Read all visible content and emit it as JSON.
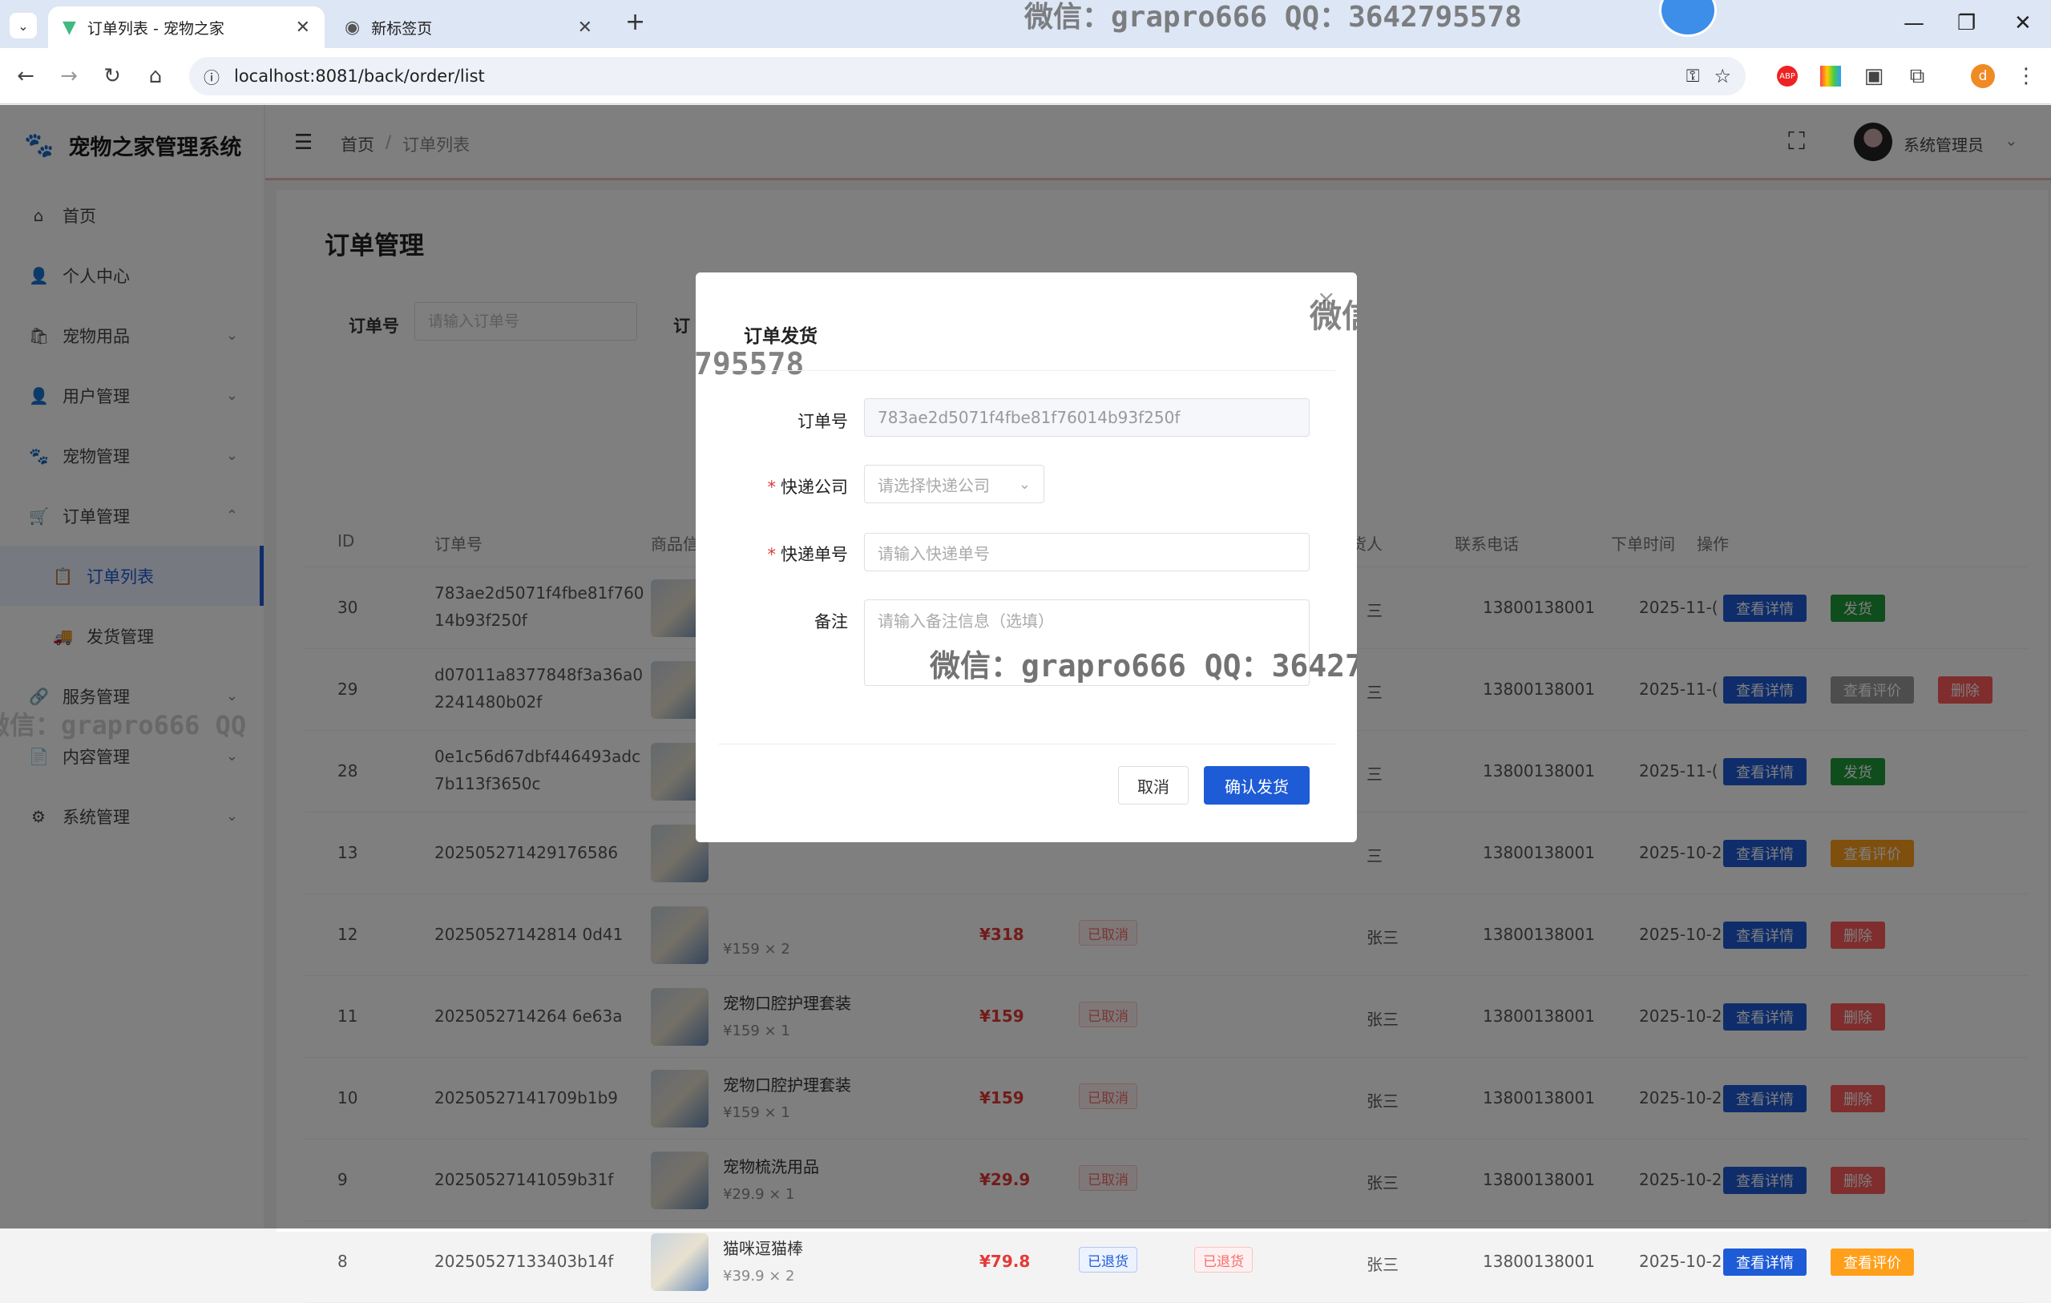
{
  "browser": {
    "tabs": [
      {
        "title": "订单列表 - 宠物之家",
        "active": true
      },
      {
        "title": "新标签页",
        "active": false
      }
    ],
    "url": "localhost:8081/back/order/list",
    "profile_initial": "d"
  },
  "watermark": "微信：grapro666 QQ：3642795578",
  "sidebar": {
    "brand": "宠物之家管理系统",
    "items": [
      {
        "label": "首页",
        "icon": "home-icon",
        "expandable": false
      },
      {
        "label": "个人中心",
        "icon": "user-icon",
        "expandable": false
      },
      {
        "label": "宠物用品",
        "icon": "bag-icon",
        "expandable": true
      },
      {
        "label": "用户管理",
        "icon": "user-icon",
        "expandable": true
      },
      {
        "label": "宠物管理",
        "icon": "paw-icon",
        "expandable": true
      },
      {
        "label": "订单管理",
        "icon": "cart-icon",
        "expandable": true,
        "open": true
      },
      {
        "label": "订单列表",
        "icon": "clipboard-icon",
        "sub": true,
        "active": true
      },
      {
        "label": "发货管理",
        "icon": "truck-icon",
        "sub": true
      },
      {
        "label": "服务管理",
        "icon": "link-icon",
        "expandable": true
      },
      {
        "label": "内容管理",
        "icon": "document-icon",
        "expandable": true
      },
      {
        "label": "系统管理",
        "icon": "gear-icon",
        "expandable": true
      }
    ]
  },
  "topbar": {
    "breadcrumb_home": "首页",
    "breadcrumb_sep": "/",
    "breadcrumb_current": "订单列表",
    "user_name": "系统管理员"
  },
  "page": {
    "title": "订单管理",
    "filter_order_label": "订单号",
    "filter_order_placeholder": "请输入订单号",
    "filter_second_label_partial": "订"
  },
  "table": {
    "headers": {
      "id": "ID",
      "order_no": "订单号",
      "goods": "商品信",
      "receiver": "货人",
      "phone": "联系电话",
      "time": "下单时间",
      "actions": "操作"
    },
    "rows": [
      {
        "id": "30",
        "order_no": [
          "783ae2d5071f4fbe81f760",
          "14b93f250f"
        ],
        "goods": "",
        "qty": "",
        "price": "",
        "status": "",
        "ship": "",
        "receiver": "三",
        "phone": "13800138001",
        "time": "2025-11-(",
        "actions": [
          {
            "label": "查看详情",
            "color": "#1e5bd6"
          },
          {
            "label": "发货",
            "color": "#1f9a39"
          }
        ]
      },
      {
        "id": "29",
        "order_no": [
          "d07011a8377848f3a36a0",
          "2241480b02f"
        ],
        "goods": "",
        "qty": "",
        "price": "",
        "status": "",
        "ship": "",
        "receiver": "三",
        "phone": "13800138001",
        "time": "2025-11-(",
        "actions": [
          {
            "label": "查看详情",
            "color": "#1e5bd6"
          },
          {
            "label": "查看评价",
            "color": "#9b9b9b"
          },
          {
            "label": "删除",
            "color": "#ff5a5a"
          }
        ]
      },
      {
        "id": "28",
        "order_no": [
          "0e1c56d67dbf446493adc",
          "7b113f3650c"
        ],
        "goods": "",
        "qty": "",
        "price": "",
        "status": "",
        "ship": "",
        "receiver": "三",
        "phone": "13800138001",
        "time": "2025-11-(",
        "actions": [
          {
            "label": "查看详情",
            "color": "#1e5bd6"
          },
          {
            "label": "发货",
            "color": "#1f9a39"
          }
        ]
      },
      {
        "id": "13",
        "order_no": [
          "202505271429176586"
        ],
        "goods": "",
        "qty": "",
        "price": "",
        "status": "",
        "ship": "",
        "receiver": "三",
        "phone": "13800138001",
        "time": "2025-10-2",
        "actions": [
          {
            "label": "查看详情",
            "color": "#1e5bd6"
          },
          {
            "label": "查看评价",
            "color": "#ff9f1a"
          }
        ]
      },
      {
        "id": "12",
        "order_no": [
          "20250527142814 0d41"
        ],
        "goods": "",
        "qty": "¥159 × 2",
        "price": "¥318",
        "status": "已取消",
        "ship": "",
        "receiver": "张三",
        "phone": "13800138001",
        "time": "2025-10-2",
        "actions": [
          {
            "label": "查看详情",
            "color": "#1e5bd6"
          },
          {
            "label": "删除",
            "color": "#ff5a5a"
          }
        ]
      },
      {
        "id": "11",
        "order_no": [
          "2025052714264 6e63a"
        ],
        "goods": "宠物口腔护理套装",
        "qty": "¥159 × 1",
        "price": "¥159",
        "status": "已取消",
        "ship": "",
        "receiver": "张三",
        "phone": "13800138001",
        "time": "2025-10-2",
        "actions": [
          {
            "label": "查看详情",
            "color": "#1e5bd6"
          },
          {
            "label": "删除",
            "color": "#ff5a5a"
          }
        ]
      },
      {
        "id": "10",
        "order_no": [
          "20250527141709b1b9"
        ],
        "goods": "宠物口腔护理套装",
        "qty": "¥159 × 1",
        "price": "¥159",
        "status": "已取消",
        "ship": "",
        "receiver": "张三",
        "phone": "13800138001",
        "time": "2025-10-2",
        "actions": [
          {
            "label": "查看详情",
            "color": "#1e5bd6"
          },
          {
            "label": "删除",
            "color": "#ff5a5a"
          }
        ]
      },
      {
        "id": "9",
        "order_no": [
          "20250527141059b31f"
        ],
        "goods": "宠物梳洗用品",
        "qty": "¥29.9 × 1",
        "price": "¥29.9",
        "status": "已取消",
        "ship": "",
        "receiver": "张三",
        "phone": "13800138001",
        "time": "2025-10-2",
        "actions": [
          {
            "label": "查看详情",
            "color": "#1e5bd6"
          },
          {
            "label": "删除",
            "color": "#ff5a5a"
          }
        ]
      },
      {
        "id": "8",
        "order_no": [
          "20250527133403b14f"
        ],
        "goods": "猫咪逗猫棒",
        "qty": "¥39.9 × 2",
        "price": "¥79.8",
        "status": "已退货",
        "ship": "已退货",
        "receiver": "张三",
        "phone": "13800138001",
        "time": "2025-10-2",
        "actions": [
          {
            "label": "查看详情",
            "color": "#1e5bd6"
          },
          {
            "label": "查看评价",
            "color": "#ff9f1a"
          }
        ]
      }
    ]
  },
  "modal": {
    "title": "订单发货",
    "order_label": "订单号",
    "order_value": "783ae2d5071f4fbe81f76014b93f250f",
    "company_label": "快递公司",
    "company_placeholder": "请选择快递公司",
    "tracking_label": "快递单号",
    "tracking_placeholder": "请输入快递单号",
    "remark_label": "备注",
    "remark_placeholder": "请输入备注信息（选填）",
    "cancel": "取消",
    "confirm": "确认发货",
    "close": "×"
  }
}
